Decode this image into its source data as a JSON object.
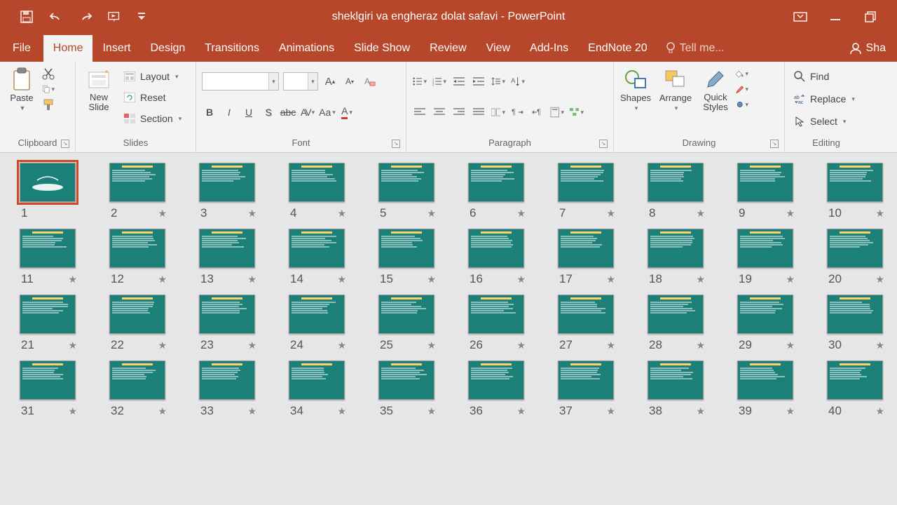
{
  "title": "sheklgiri va engheraz dolat safavi - PowerPoint",
  "tabs": {
    "file": "File",
    "home": "Home",
    "insert": "Insert",
    "design": "Design",
    "transitions": "Transitions",
    "animations": "Animations",
    "slideshow": "Slide Show",
    "review": "Review",
    "view": "View",
    "addins": "Add-Ins",
    "endnote": "EndNote 20",
    "tellme": "Tell me...",
    "share": "Sha"
  },
  "groups": {
    "clipboard": {
      "label": "Clipboard",
      "paste": "Paste"
    },
    "slides": {
      "label": "Slides",
      "new_slide": "New\nSlide",
      "layout": "Layout",
      "reset": "Reset",
      "section": "Section"
    },
    "font": {
      "label": "Font"
    },
    "paragraph": {
      "label": "Paragraph"
    },
    "drawing": {
      "label": "Drawing",
      "shapes": "Shapes",
      "arrange": "Arrange",
      "quick_styles": "Quick\nStyles"
    },
    "editing": {
      "label": "Editing",
      "find": "Find",
      "replace": "Replace",
      "select": "Select"
    }
  },
  "slides": {
    "count": 40,
    "selected": 1,
    "visible_rows": 4,
    "per_row": 10
  },
  "colors": {
    "brand": "#b7472a",
    "thumb": "#1a8078",
    "accent": "#ffd070"
  }
}
